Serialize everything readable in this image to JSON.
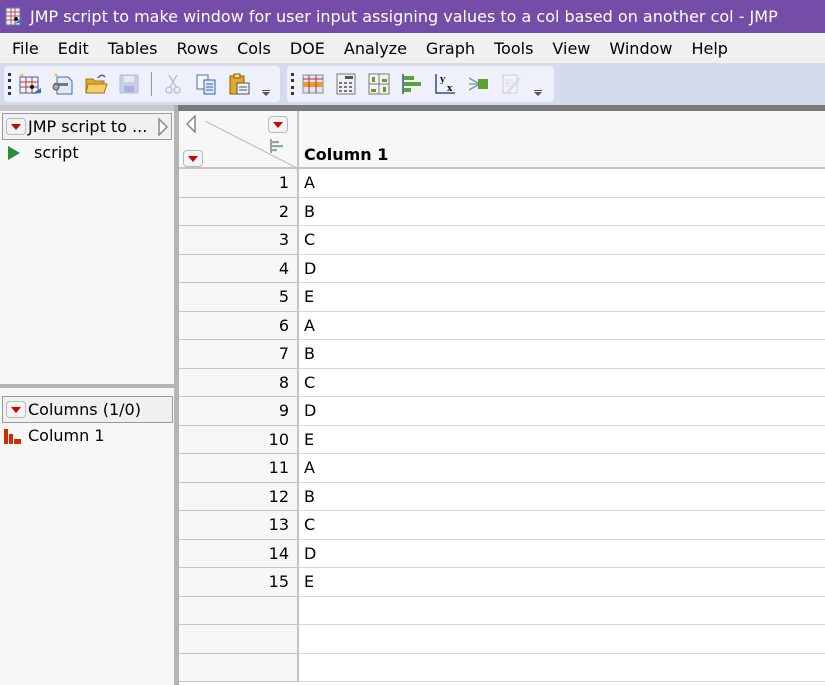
{
  "window": {
    "title": "JMP script to make window for user input assigning values to a col based on another col - JMP",
    "app_icon": "jmp-data-table-icon"
  },
  "menubar": {
    "items": [
      "File",
      "Edit",
      "Tables",
      "Rows",
      "Cols",
      "DOE",
      "Analyze",
      "Graph",
      "Tools",
      "View",
      "Window",
      "Help"
    ]
  },
  "toolbar": {
    "group1": [
      "new-data-table-icon",
      "new-script-icon",
      "open-icon",
      "save-icon",
      "cut-icon",
      "copy-icon",
      "paste-icon"
    ],
    "group2": [
      "data-table-view-icon",
      "column-info-icon",
      "distribution-icon",
      "bar-chart-icon",
      "fit-y-by-x-icon",
      "fit-model-icon",
      "edit-script-icon"
    ]
  },
  "table_panel": {
    "title": "JMP script to ...",
    "scripts": [
      "script"
    ]
  },
  "columns_panel": {
    "title": "Columns (1/0)",
    "columns": [
      "Column 1"
    ]
  },
  "grid": {
    "columns": [
      "Column 1",
      "",
      "",
      "",
      ""
    ],
    "rows": [
      {
        "n": "1",
        "v": "A"
      },
      {
        "n": "2",
        "v": "B"
      },
      {
        "n": "3",
        "v": "C"
      },
      {
        "n": "4",
        "v": "D"
      },
      {
        "n": "5",
        "v": "E"
      },
      {
        "n": "6",
        "v": "A"
      },
      {
        "n": "7",
        "v": "B"
      },
      {
        "n": "8",
        "v": "C"
      },
      {
        "n": "9",
        "v": "D"
      },
      {
        "n": "10",
        "v": "E"
      },
      {
        "n": "11",
        "v": "A"
      },
      {
        "n": "12",
        "v": "B"
      },
      {
        "n": "13",
        "v": "C"
      },
      {
        "n": "14",
        "v": "D"
      },
      {
        "n": "15",
        "v": "E"
      },
      {
        "n": "",
        "v": ""
      },
      {
        "n": "",
        "v": ""
      },
      {
        "n": "",
        "v": ""
      }
    ]
  },
  "colors": {
    "titlebar": "#744da9",
    "menubar": "#f0f0f0",
    "toolbar_bg": "#d5daed",
    "red_triangle": "#d00000",
    "script_triangle": "#2e8b3a",
    "column_icon": "#d42a00"
  }
}
